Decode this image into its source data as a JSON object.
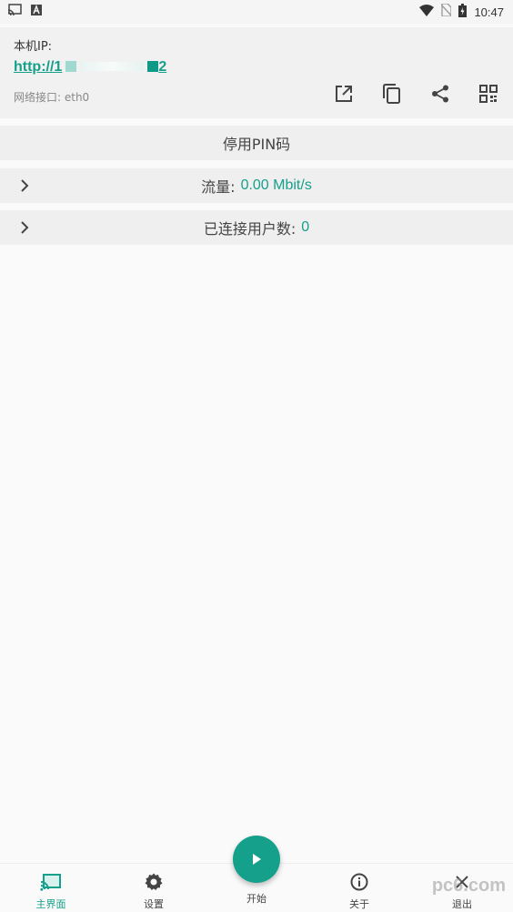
{
  "status_bar": {
    "time": "10:47",
    "left_icons": [
      "cast-icon",
      "a-notification-icon"
    ],
    "right_icons": [
      "wifi-icon",
      "no-sim-icon",
      "battery-icon"
    ]
  },
  "ip_card": {
    "label": "本机IP:",
    "url_start": "http://1",
    "url_end": "2",
    "interface": "网络接口: eth0",
    "actions": [
      "open-external-icon",
      "copy-icon",
      "share-icon",
      "qr-code-icon"
    ]
  },
  "rows": {
    "pin": {
      "label": "停用PIN码"
    },
    "flow": {
      "label": "流量:",
      "value": "0.00 Mbit/s"
    },
    "users": {
      "label": "已连接用户数:",
      "value": "0"
    }
  },
  "bottom_nav": {
    "home": "主界面",
    "settings": "设置",
    "start": "开始",
    "about": "关于",
    "exit": "退出"
  },
  "watermark": "pc6.com",
  "colors": {
    "accent": "#15a08b",
    "row_bg": "#efefef",
    "background": "#fafafa"
  }
}
